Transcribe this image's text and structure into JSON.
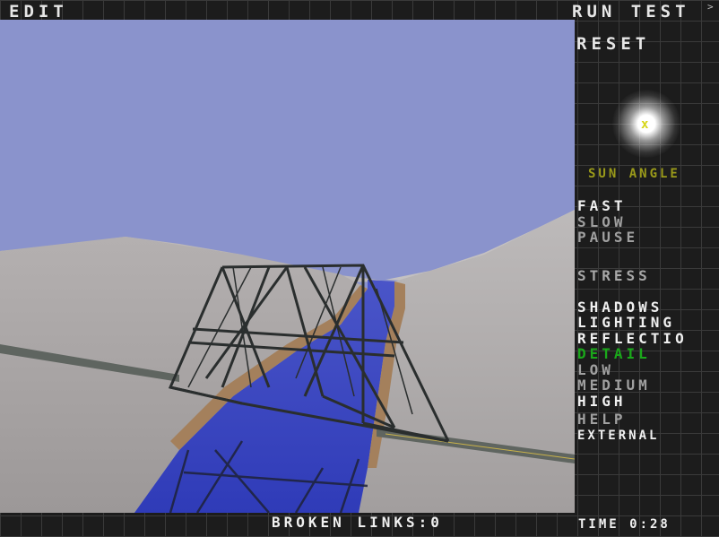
{
  "toolbar": {
    "edit": "Edit",
    "run_test": "Run Test",
    "reset": "Reset"
  },
  "sun": {
    "marker": "x",
    "label": "Sun Angle"
  },
  "speed": {
    "fast": "Fast",
    "slow": "Slow",
    "pause": "Pause"
  },
  "view": {
    "stress": "Stress",
    "shadows": "Shadows",
    "lighting": "Lighting",
    "reflections": "Reflectio",
    "detail": "Detail",
    "low": "Low",
    "medium": "Medium",
    "high": "High",
    "help": "Help",
    "external": "External"
  },
  "status": {
    "broken_links": "Broken Links:0",
    "time": "Time 0:28"
  },
  "colors": {
    "sky": "#8a93cc",
    "water": "#3a46c0",
    "terrain": "#a8a4a4",
    "detail_active": "#1aa81a",
    "sun_label": "#9a9a1a"
  }
}
